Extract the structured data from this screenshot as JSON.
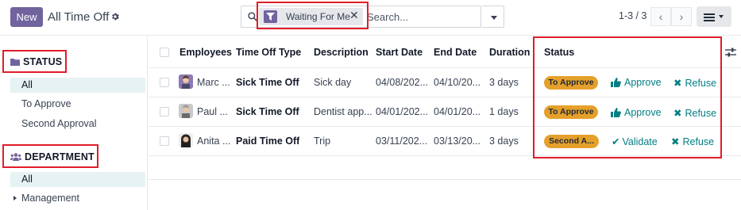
{
  "control_panel": {
    "new_label": "New",
    "title": "All Time Off",
    "search": {
      "facet_label": "Waiting For Me",
      "placeholder": "Search..."
    },
    "pager": "1-3 / 3"
  },
  "sidebar": {
    "status": {
      "heading": "STATUS",
      "items": [
        "All",
        "To Approve",
        "Second Approval"
      ]
    },
    "department": {
      "heading": "DEPARTMENT",
      "items": [
        "All",
        "Management"
      ]
    }
  },
  "table": {
    "columns": [
      "Employees",
      "Time Off Type",
      "Description",
      "Start Date",
      "End Date",
      "Duration",
      "Status"
    ],
    "rows": [
      {
        "employee": "Marc ...",
        "type": "Sick Time Off",
        "description": "Sick day",
        "start": "04/08/202...",
        "end": "04/10/20...",
        "duration": "3 days",
        "status": "To Approve",
        "action1": "Approve",
        "action2": "Refuse"
      },
      {
        "employee": "Paul ...",
        "type": "Sick Time Off",
        "description": "Dentist app...",
        "start": "04/01/202...",
        "end": "04/01/20...",
        "duration": "1 days",
        "status": "To Approve",
        "action1": "Approve",
        "action2": "Refuse"
      },
      {
        "employee": "Anita ...",
        "type": "Paid Time Off",
        "description": "Trip",
        "start": "03/11/202...",
        "end": "03/13/20...",
        "duration": "3 days",
        "status": "Second A...",
        "action1": "Validate",
        "action2": "Refuse"
      }
    ]
  },
  "colors": {
    "brand": "#71639e",
    "action": "#017e84",
    "status_badge": "#e5a02b",
    "annotation": "#e11d2a",
    "sidebar_active": "#e6f2f3"
  }
}
